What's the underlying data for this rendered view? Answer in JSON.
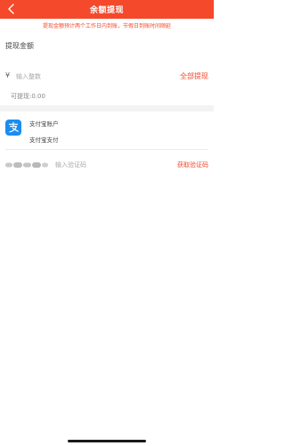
{
  "navbar": {
    "title": "余额提现",
    "back_icon": "chevron-left-icon",
    "background": "#f4492b"
  },
  "notice": {
    "text": "提现金额预计两个工作日内到账，节假日到账时间顺延"
  },
  "withdraw": {
    "section_title": "提现金额",
    "currency_symbol": "¥",
    "amount_placeholder": "输入整数",
    "amount_value": "",
    "withdraw_all_label": "全部提现",
    "available_text": "可提现:0.00"
  },
  "account": {
    "icon": "alipay-icon",
    "name": "支付宝账户",
    "subtitle": "支付宝支付",
    "brand_color": "#1b8df0"
  },
  "verification": {
    "phone_masked_icon": "blurred-phone-number",
    "code_placeholder": "输入验证码",
    "code_value": "",
    "get_code_label": "获取验证码"
  },
  "colors": {
    "accent": "#f4492b",
    "divider": "#f3f3f3"
  }
}
